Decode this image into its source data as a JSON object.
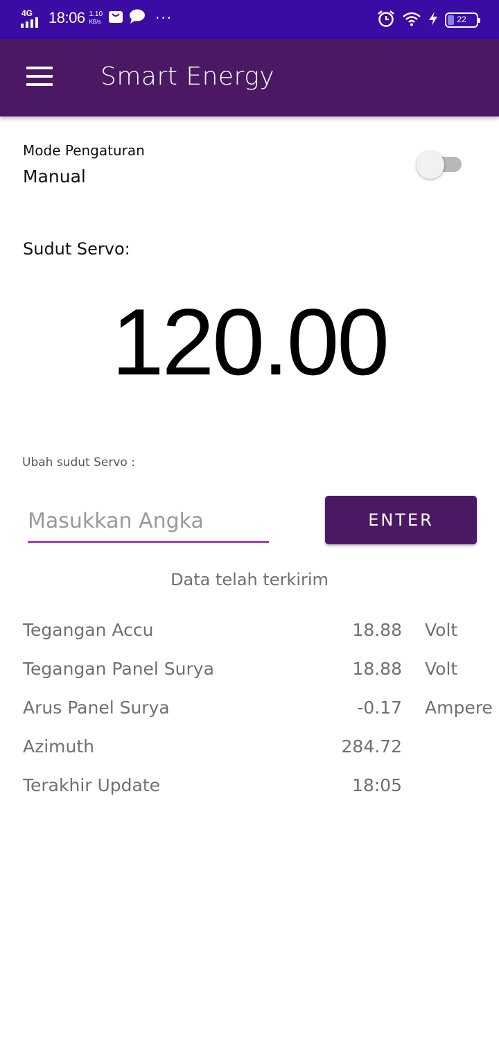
{
  "status_bar": {
    "network": "4G",
    "time": "18:06",
    "speed_value": "1.10",
    "speed_unit": "KB/s",
    "more": "···",
    "battery": "22",
    "battery_level": 0.22
  },
  "app_bar": {
    "title": "Smart Energy",
    "menu_icon": "hamburger-menu-icon"
  },
  "mode": {
    "label": "Mode Pengaturan",
    "value": "Manual",
    "switch_on": false
  },
  "servo": {
    "label": "Sudut Servo:",
    "value": "120.00"
  },
  "change_servo": {
    "label": "Ubah sudut Servo :",
    "placeholder": "Masukkan Angka",
    "button_label": "ENTER"
  },
  "status_message": "Data telah terkirim",
  "readings": [
    {
      "label": "Tegangan Accu",
      "value": "18.88",
      "unit": "Volt"
    },
    {
      "label": "Tegangan Panel Surya",
      "value": "18.88",
      "unit": "Volt"
    },
    {
      "label": "Arus Panel Surya",
      "value": "-0.17",
      "unit": "Ampere"
    },
    {
      "label": "Azimuth",
      "value": "284.72",
      "unit": ""
    },
    {
      "label": "Terakhir Update",
      "value": "18:05",
      "unit": ""
    }
  ],
  "colors": {
    "status_bar": "#3a0ca3",
    "app_bar": "#4b1964",
    "input_underline": "#b03ad0",
    "muted_text": "#707070"
  }
}
